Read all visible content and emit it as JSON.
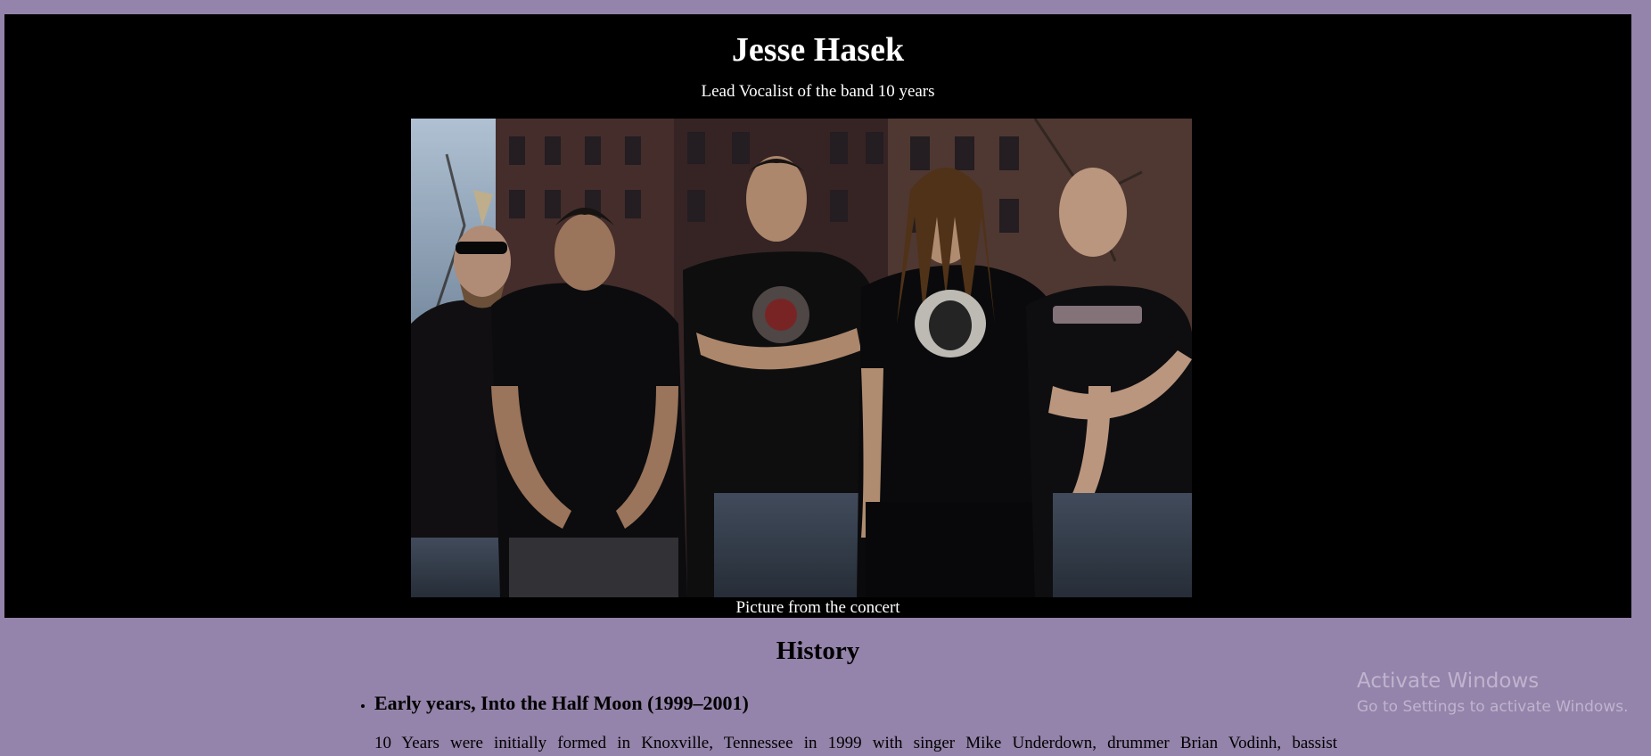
{
  "header": {
    "title": "Jesse Hasek",
    "subtitle": "Lead Vocalist of the band 10 years"
  },
  "photo": {
    "alt": "10 Years band photo",
    "caption": "Picture from the concert"
  },
  "history": {
    "heading": "History",
    "sections": [
      {
        "title": "Early years, Into the Half Moon (1999–2001)",
        "text": "10 Years were initially formed in Knoxville, Tennessee in 1999 with singer Mike Underdown, drummer Brian Vodinh, bassist"
      }
    ]
  },
  "watermark": {
    "title": "Activate Windows",
    "subtitle": "Go to Settings to activate Windows."
  },
  "colors": {
    "page_background": "#9483aa",
    "hero_background": "#000000",
    "hero_text": "#ffffff"
  }
}
